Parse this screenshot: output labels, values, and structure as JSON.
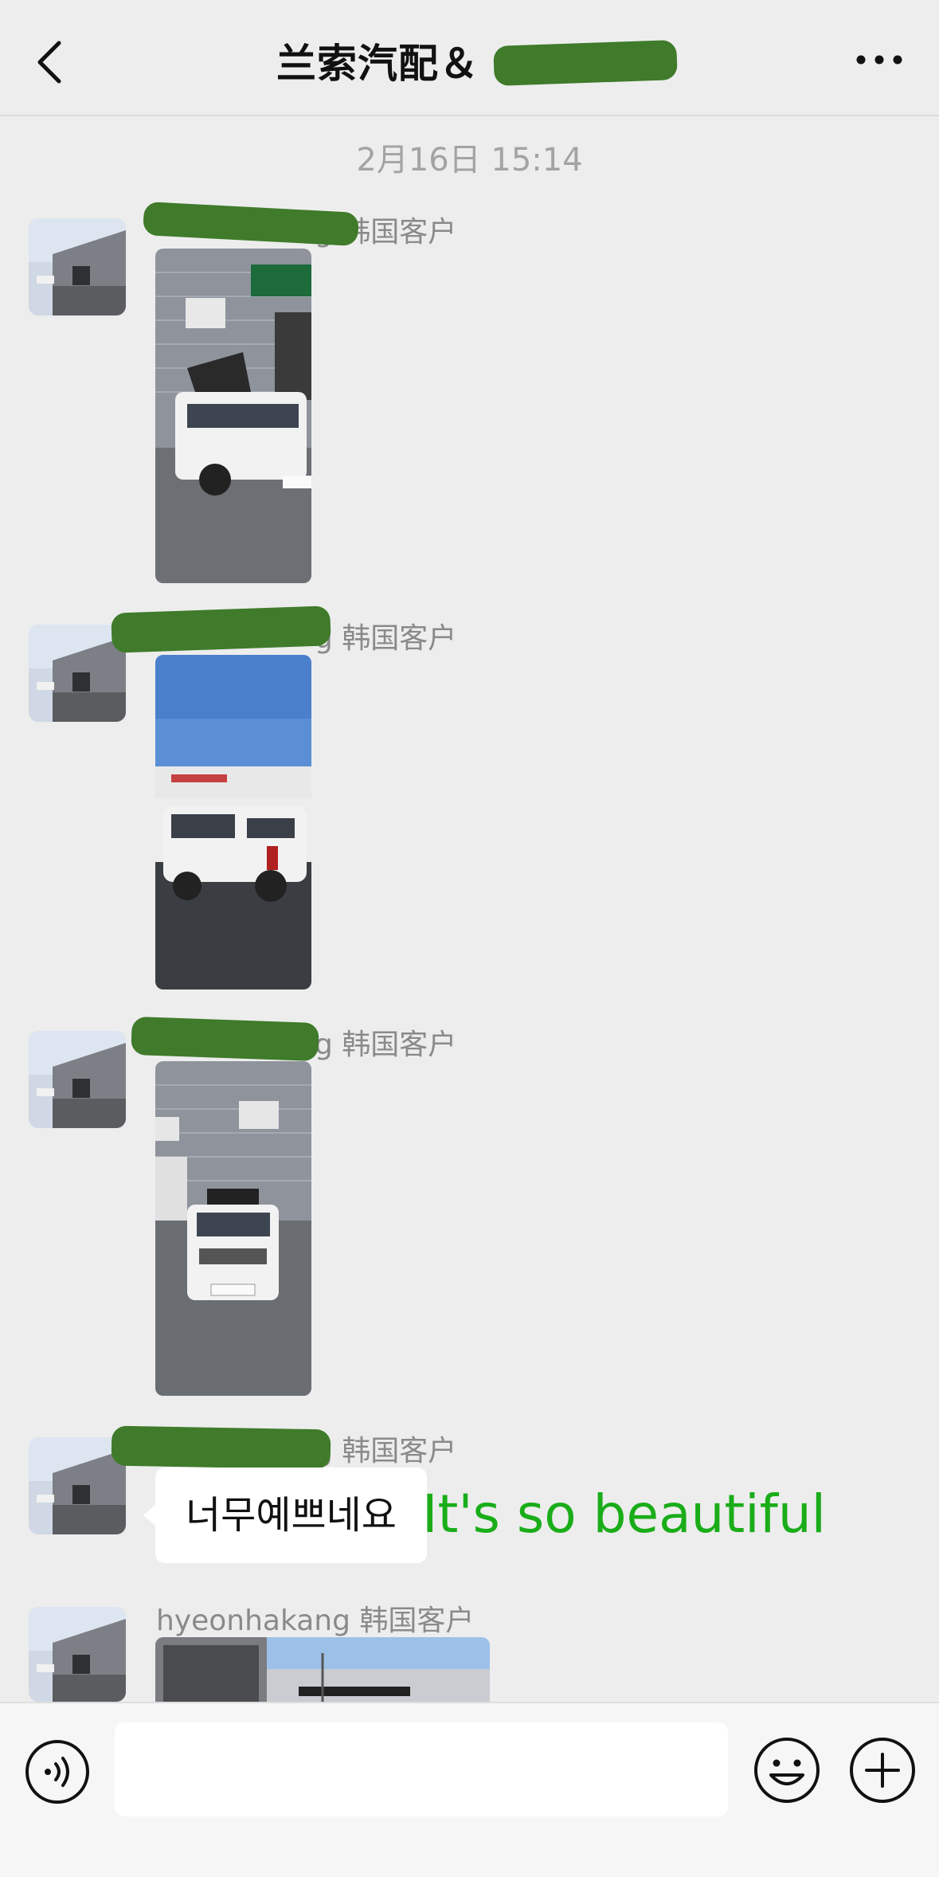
{
  "header": {
    "title": "兰索汽配＆",
    "more_icon": "more-horizontal-icon",
    "back_icon": "chevron-left-icon"
  },
  "timestamp": "2月16日 15:14",
  "messages": [
    {
      "sender_visible": "g 韩国客户",
      "type": "image",
      "image_desc": "white-suv-with-rooftop-tent"
    },
    {
      "sender_visible": "g 韩国客户",
      "type": "image",
      "image_desc": "white-suv-rear-view"
    },
    {
      "sender_visible": "g 韩国客户",
      "type": "image",
      "image_desc": "white-suv-front-view"
    },
    {
      "sender_visible": "g 韩国客户",
      "type": "text",
      "text": "너무예쁘네요",
      "translation": "It's so beautiful"
    },
    {
      "sender_visible": "hyeonhakang 韩国客户",
      "type": "image",
      "image_desc": "suv-outdoor-partial"
    }
  ],
  "input_bar": {
    "value": "",
    "voice_icon": "voice-icon",
    "emoji_icon": "emoji-icon",
    "plus_icon": "plus-icon"
  },
  "colors": {
    "background": "#ededed",
    "translation_green": "#1aad19",
    "redaction_green": "#3f7b2a"
  }
}
